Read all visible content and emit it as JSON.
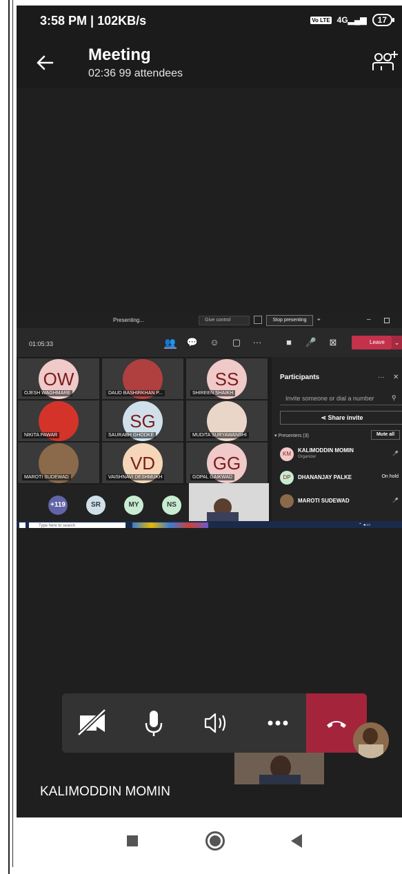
{
  "status_bar": {
    "time": "3:58 PM | 102KB/s",
    "volte": "Vo LTE",
    "signal": "4G",
    "battery": "17"
  },
  "header": {
    "title": "Meeting",
    "subtitle": "02:36  99 attendees"
  },
  "shared_screen": {
    "presenting_label": "Presenting...",
    "give_control": "Give control",
    "stop_presenting": "Stop presenting",
    "call_timer": "01:05:33",
    "leave_label": "Leave",
    "tiles": [
      {
        "initials": "OW",
        "name": "OJESH WAGHMARE",
        "avatar_color": "#f0c9c9",
        "photo": false
      },
      {
        "initials": "",
        "name": "DAUD BASHIRKHAN P...",
        "avatar_color": "#b04040",
        "photo": true
      },
      {
        "initials": "SS",
        "name": "SHIREEN SHAIKH",
        "avatar_color": "#f0c9c9",
        "photo": false
      },
      {
        "initials": "",
        "name": "NIKITA PAWAR",
        "avatar_color": "#d4332a",
        "photo": true
      },
      {
        "initials": "SG",
        "name": "SAURABH GHODKE",
        "avatar_color": "#cfe0ea",
        "photo": false
      },
      {
        "initials": "",
        "name": "MUDITA SURYAWANSHI",
        "avatar_color": "#ead6c8",
        "photo": true
      },
      {
        "initials": "",
        "name": "MAROTI SUDEWAD",
        "avatar_color": "#8a6a4b",
        "photo": true
      },
      {
        "initials": "VD",
        "name": "VAISHNAVI DESHMUKH",
        "avatar_color": "#f5d6b8",
        "photo": false
      },
      {
        "initials": "GG",
        "name": "GOPAL GAIKWAD",
        "avatar_color": "#f0c9c9",
        "photo": false
      }
    ],
    "overflow_avatars": [
      {
        "label": "+119",
        "color": "#6264a7"
      },
      {
        "label": "SR",
        "color": "#cfe0ea"
      },
      {
        "label": "MY",
        "color": "#c8ecd2"
      },
      {
        "label": "NS",
        "color": "#c8ecd2"
      }
    ],
    "participants_panel": {
      "title": "Participants",
      "invite_placeholder": "Invite someone or dial a number",
      "share_invite": "Share invite",
      "presenters_header": "Presenters (3)",
      "mute_all": "Mute all",
      "people": [
        {
          "initials": "KM",
          "name": "KALIMODDIN MOMIN",
          "role": "Organizer",
          "status": "",
          "color": "#f0c9c9"
        },
        {
          "initials": "DP",
          "name": "DHANANJAY PALKE",
          "role": "",
          "status": "On hold",
          "color": "#c8ecd2"
        },
        {
          "initials": "",
          "name": "MAROTI SUDEWAD",
          "role": "",
          "status": "",
          "color": "#8a6a4b"
        }
      ]
    },
    "taskbar_search": "Type here to search"
  },
  "controls": {
    "camera": "camera-off-icon",
    "mic": "microphone-icon",
    "speaker": "speaker-icon",
    "more": "more-icon",
    "hangup": "hang-up-icon"
  },
  "speaker_name": "KALIMODDIN MOMIN"
}
